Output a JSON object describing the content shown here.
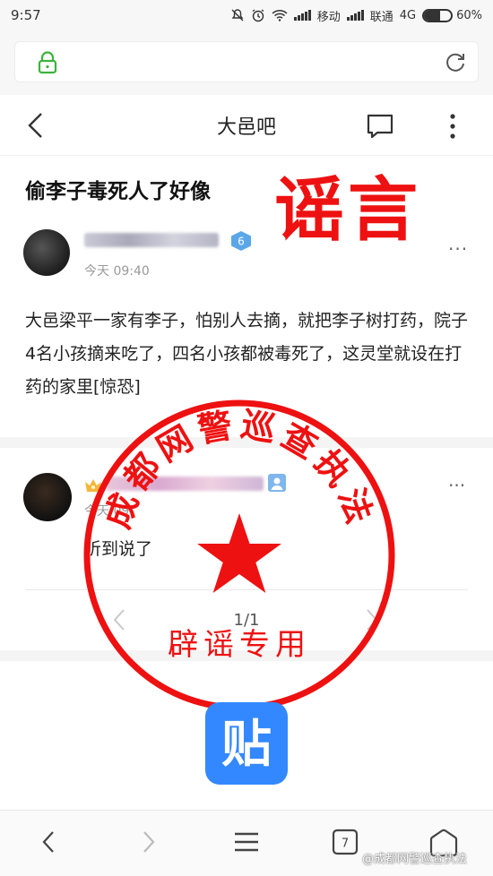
{
  "status_bar": {
    "time": "9:57",
    "carrier_1": "移动",
    "carrier_2": "联通",
    "network": "4G",
    "battery": "60%",
    "battery_level": 0.6,
    "icons": [
      "mute-icon",
      "alarm-icon",
      "wifi-icon",
      "signal-icon",
      "battery-icon"
    ]
  },
  "browser": {
    "address_icons": [
      "lock-icon",
      "refresh-icon"
    ],
    "toolbar": {
      "tabs_count": "7",
      "icons": [
        "back-icon",
        "forward-icon",
        "menu-icon",
        "tabs-icon",
        "home-icon"
      ]
    }
  },
  "header": {
    "title": "大邑吧"
  },
  "post": {
    "title": "偷李子毒死人了好像",
    "level": "6",
    "time": "今天 09:40",
    "body": "大邑梁平一家有李子，怕别人去摘，就把李子树打药，院子4名小孩摘来吃了，四名小孩都被毒死了，这灵堂就设在打药的家里[惊恐]",
    "more": "···"
  },
  "overlay": {
    "rumor_label": "谣言",
    "seal_arc_text": "成都网警巡查执法",
    "seal_bottom_text": "辟谣专用",
    "seal_color": "#ee1111"
  },
  "reply": {
    "time": "今天 09",
    "text": "听到说了",
    "more": "···"
  },
  "pagination": {
    "text": "1/1"
  },
  "app_logo": {
    "label": "贴",
    "color": "#3388ff"
  },
  "watermark": "@成都网警巡查执法"
}
